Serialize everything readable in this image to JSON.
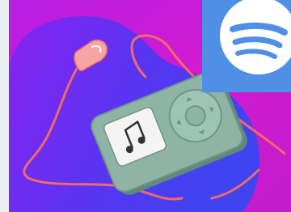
{
  "colors": {
    "background_magenta": "#d21ad0",
    "background_purple": "#9b1de8",
    "blob_blue": "#4b3cf0",
    "blob_violet": "#8a22f0",
    "tile_blue": "#4f8fe6",
    "spotify_white": "#ffffff",
    "player_body": "#8fb4a6",
    "player_shadow": "#5e8a7c",
    "player_screen": "#f4f4f4",
    "cable_color": "#f06a6a",
    "earbud_color": "#f6a4a4",
    "left_edge": "#e9eef2"
  },
  "icons": {
    "spotify": "spotify-logo-icon",
    "music_note": "music-note-icon",
    "click_wheel": "click-wheel-icon"
  }
}
